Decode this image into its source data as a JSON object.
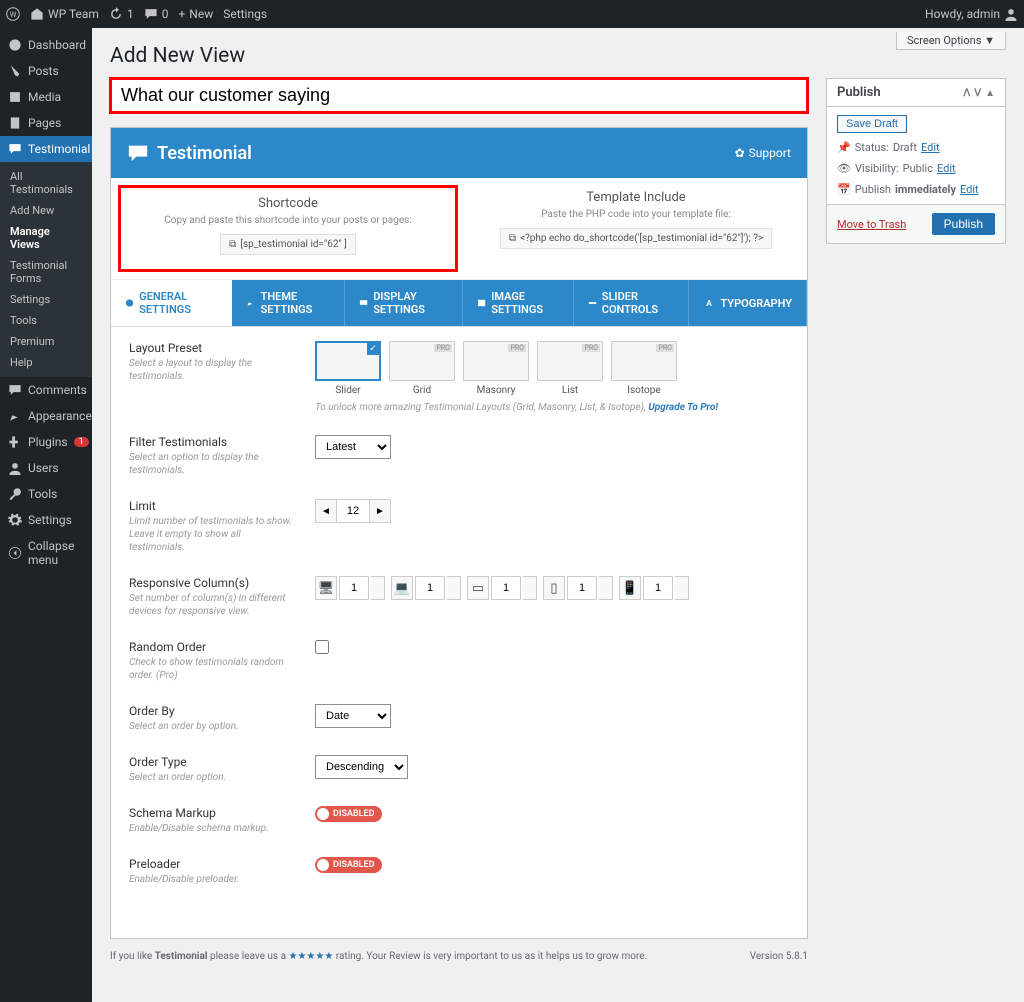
{
  "adminbar": {
    "site": "WP Team",
    "updates": "1",
    "comments": "0",
    "new": "New",
    "settings": "Settings",
    "howdy": "Howdy, admin"
  },
  "screen_options": "Screen Options ▼",
  "sidebar": {
    "items": [
      {
        "label": "Dashboard",
        "icon": "dash"
      },
      {
        "label": "Posts",
        "icon": "pin"
      },
      {
        "label": "Media",
        "icon": "media"
      },
      {
        "label": "Pages",
        "icon": "page"
      },
      {
        "label": "Testimonial",
        "icon": "testimonial",
        "active": true
      },
      {
        "label": "Comments",
        "icon": "comment"
      },
      {
        "label": "Appearance",
        "icon": "brush"
      },
      {
        "label": "Plugins",
        "icon": "plugin",
        "badge": "1"
      },
      {
        "label": "Users",
        "icon": "user"
      },
      {
        "label": "Tools",
        "icon": "tool"
      },
      {
        "label": "Settings",
        "icon": "gear"
      },
      {
        "label": "Collapse menu",
        "icon": "collapse"
      }
    ],
    "sub": [
      "All Testimonials",
      "Add New",
      "Manage Views",
      "Testimonial Forms",
      "Settings",
      "Tools",
      "Premium",
      "Help"
    ],
    "sub_selected": "Manage Views"
  },
  "page_title": "Add New View",
  "title_value": "What our customer saying",
  "publish": {
    "title": "Publish",
    "save_draft": "Save Draft",
    "status_label": "Status:",
    "status_value": "Draft",
    "visibility_label": "Visibility:",
    "visibility_value": "Public",
    "schedule_label": "Publish",
    "schedule_value": "immediately",
    "edit": "Edit",
    "trash": "Move to Trash",
    "publish_btn": "Publish"
  },
  "plugin_header": {
    "title": "Testimonial",
    "support": "Support"
  },
  "shortcode": {
    "title": "Shortcode",
    "desc": "Copy and paste this shortcode into your posts or pages:",
    "code": "[sp_testimonial id=\"62\" ]"
  },
  "template": {
    "title": "Template Include",
    "desc": "Paste the PHP code into your template file:",
    "code": "<?php echo do_shortcode('[sp_testimonial id=\"62\"]'); ?>"
  },
  "tabs": [
    "GENERAL SETTINGS",
    "THEME SETTINGS",
    "DISPLAY SETTINGS",
    "IMAGE SETTINGS",
    "SLIDER CONTROLS",
    "TYPOGRAPHY"
  ],
  "fields": {
    "layout": {
      "name": "Layout Preset",
      "desc": "Select a layout to display the testimonials."
    },
    "layouts": [
      "Slider",
      "Grid",
      "Masonry",
      "List",
      "Isotope"
    ],
    "upgrade_note": "To unlock more amazing Testimonial Layouts (Grid, Masonry, List, & Isotope),",
    "upgrade_link": "Upgrade To Pro!",
    "filter": {
      "name": "Filter Testimonials",
      "desc": "Select an option to display the testimonials.",
      "value": "Latest"
    },
    "limit": {
      "name": "Limit",
      "desc": "Limit number of testimonials to show. Leave it empty to show all testimonials.",
      "value": "12"
    },
    "responsive": {
      "name": "Responsive Column(s)",
      "desc": "Set number of column(s) in different devices for responsive view.",
      "values": [
        "1",
        "1",
        "1",
        "1",
        "1"
      ]
    },
    "random": {
      "name": "Random Order",
      "desc": "Check to show testimonials random order. (Pro)"
    },
    "orderby": {
      "name": "Order By",
      "desc": "Select an order by option.",
      "value": "Date"
    },
    "ordertype": {
      "name": "Order Type",
      "desc": "Select an order option.",
      "value": "Descending"
    },
    "schema": {
      "name": "Schema Markup",
      "desc": "Enable/Disable schema markup.",
      "value": "DISABLED"
    },
    "preloader": {
      "name": "Preloader",
      "desc": "Enable/Disable preloader.",
      "value": "DISABLED"
    }
  },
  "footer": {
    "left_pre": "If you like ",
    "plugin": "Testimonial",
    "left_mid": " please leave us a ",
    "stars": "★★★★★",
    "left_post": " rating. Your Review is very important to us as it helps us to grow more.",
    "version": "Version 5.8.1"
  }
}
